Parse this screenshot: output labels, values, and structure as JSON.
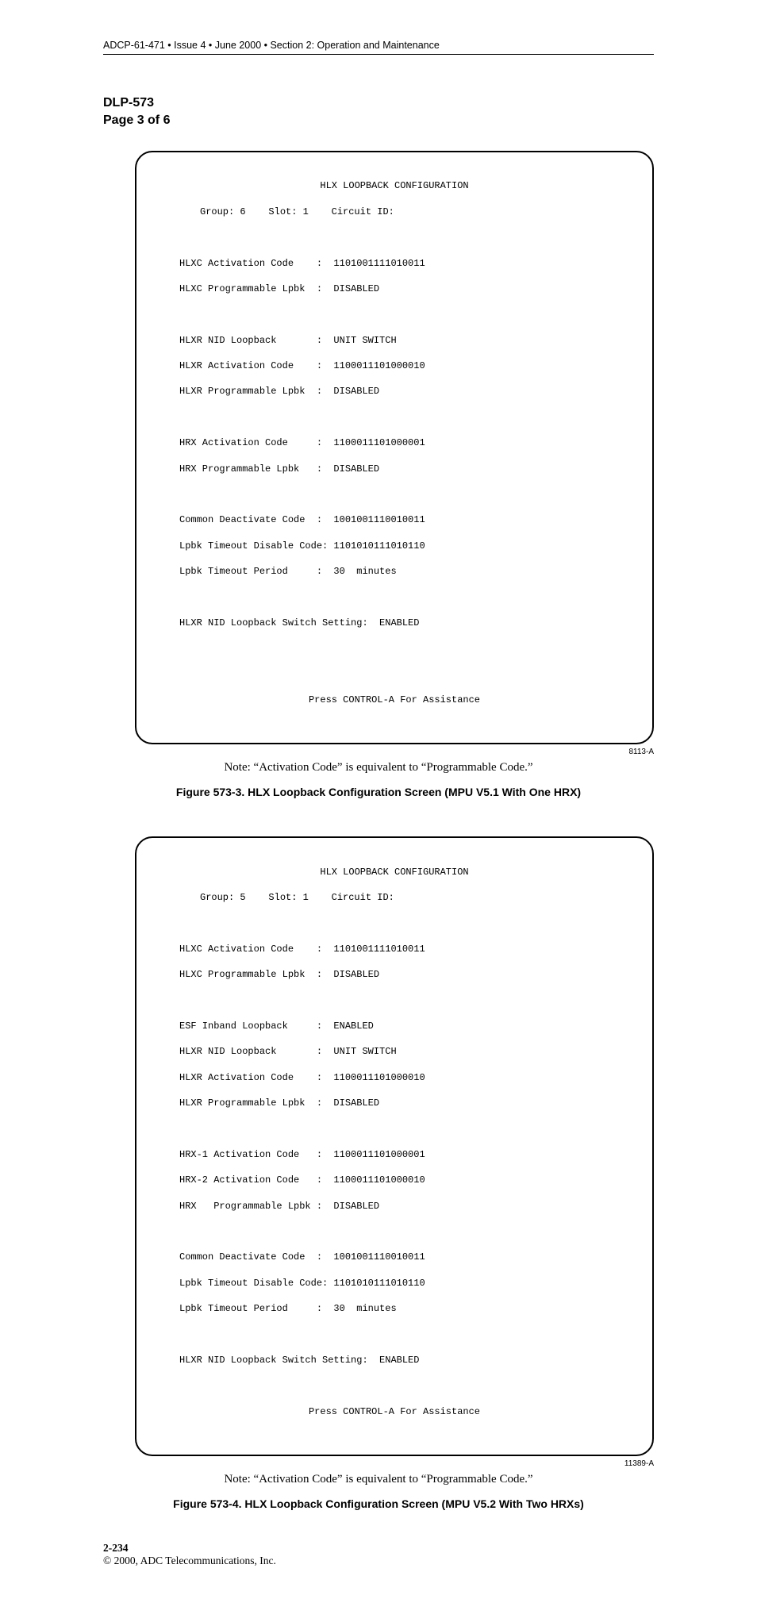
{
  "header": "ADCP-61-471 • Issue 4 • June 2000 • Section 2: Operation and Maintenance",
  "dlp": {
    "code": "DLP-573",
    "page": "Page 3 of 6"
  },
  "screen1": {
    "title": "HLX LOOPBACK CONFIGURATION",
    "sub": "Group: 6    Slot: 1    Circuit ID:",
    "l1": "HLXC Activation Code    :  1101001111010011",
    "l2": "HLXC Programmable Lpbk  :  DISABLED",
    "l3": "HLXR NID Loopback       :  UNIT SWITCH",
    "l4": "HLXR Activation Code    :  1100011101000010",
    "l5": "HLXR Programmable Lpbk  :  DISABLED",
    "l6": "HRX Activation Code     :  1100011101000001",
    "l7": "HRX Programmable Lpbk   :  DISABLED",
    "l8": "Common Deactivate Code  :  1001001110010011",
    "l9": "Lpbk Timeout Disable Code: 1101010111010110",
    "l10": "Lpbk Timeout Period     :  30  minutes",
    "l11": "HLXR NID Loopback Switch Setting:  ENABLED",
    "footer": "Press CONTROL-A For Assistance",
    "id": "8113-A"
  },
  "note1": "Note: “Activation Code” is equivalent to “Programmable Code.”",
  "caption1": "Figure 573-3. HLX Loopback Configuration Screen (MPU V5.1 With One HRX)",
  "screen2": {
    "title": "HLX LOOPBACK CONFIGURATION",
    "sub": "Group: 5    Slot: 1    Circuit ID:",
    "l1": "HLXC Activation Code    :  1101001111010011",
    "l2": "HLXC Programmable Lpbk  :  DISABLED",
    "l3": "ESF Inband Loopback     :  ENABLED",
    "l4": "HLXR NID Loopback       :  UNIT SWITCH",
    "l5": "HLXR Activation Code    :  1100011101000010",
    "l6": "HLXR Programmable Lpbk  :  DISABLED",
    "l7": "HRX-1 Activation Code   :  1100011101000001",
    "l8": "HRX-2 Activation Code   :  1100011101000010",
    "l9": "HRX   Programmable Lpbk :  DISABLED",
    "l10": "Common Deactivate Code  :  1001001110010011",
    "l11": "Lpbk Timeout Disable Code: 1101010111010110",
    "l12": "Lpbk Timeout Period     :  30  minutes",
    "l13": "HLXR NID Loopback Switch Setting:  ENABLED",
    "footer": "Press CONTROL-A For Assistance",
    "id": "11389-A"
  },
  "note2": "Note: “Activation Code” is equivalent to “Programmable Code.”",
  "caption2": "Figure 573-4. HLX Loopback Configuration Screen (MPU V5.2 With Two HRXs)",
  "footer": {
    "pagenum": "2-234",
    "copyright": "© 2000, ADC Telecommunications, Inc."
  }
}
